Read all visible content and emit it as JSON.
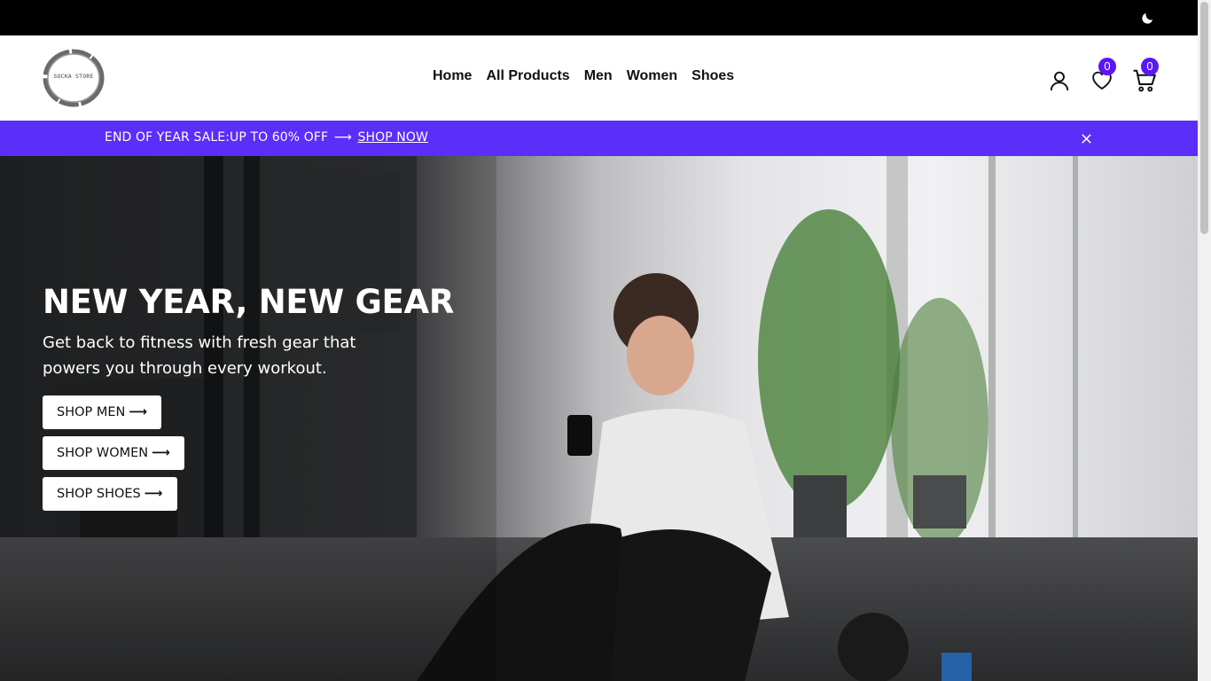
{
  "topbar": {
    "theme_icon": "moon-icon"
  },
  "header": {
    "logo_text": "SOCKA STORE",
    "nav": [
      "Home",
      "All Products",
      "Men",
      "Women",
      "Shoes"
    ],
    "wishlist_count": "0",
    "cart_count": "0",
    "accent": "#5b16f5"
  },
  "promo": {
    "text": "END OF YEAR SALE:UP TO 60% OFF",
    "arrow": "⟶",
    "link": "SHOP NOW",
    "background": "#5b2ef9"
  },
  "hero": {
    "title": "NEW YEAR, NEW GEAR",
    "subtitle": "Get back to fitness with fresh gear that powers you through every workout.",
    "buttons": {
      "men": "SHOP MEN",
      "women": "SHOP WOMEN",
      "shoes": "SHOP SHOES"
    },
    "arrow": "⟶"
  }
}
